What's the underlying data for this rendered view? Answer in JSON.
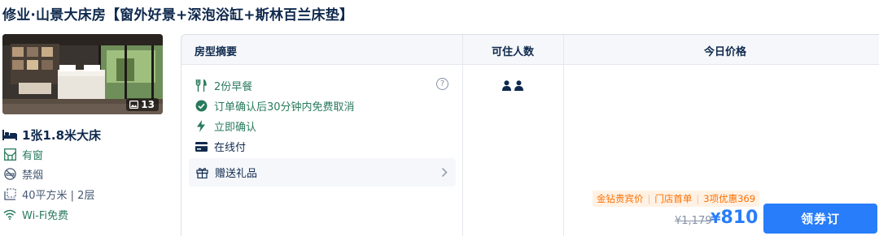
{
  "room": {
    "title": "修业·山景大床房【窗外好景+深泡浴缸+斯林百兰床垫】",
    "photo_count": "13",
    "bed": "1张1.8米大床",
    "window": "有窗",
    "smoking": "禁烟",
    "area_floor": "40平方米 | 2层",
    "wifi": "Wi-Fi免费"
  },
  "table": {
    "headers": {
      "summary": "房型摘要",
      "guests": "可住人数",
      "price": "今日价格"
    }
  },
  "perks": {
    "breakfast": "2份早餐",
    "cancel": "订单确认后30分钟内免费取消",
    "instant": "立即确认",
    "payment": "在线付",
    "gift": "赠送礼品"
  },
  "guests": {
    "count": 2,
    "icon": "person-icon"
  },
  "pricing": {
    "promo_tags": [
      "金钻贵宾价",
      "门店首单",
      "3项优惠369"
    ],
    "original_price": "¥1,179",
    "currency": "¥",
    "price": "810",
    "book_label": "领券订"
  },
  "colors": {
    "accent_blue": "#287dfa",
    "green": "#287a5c",
    "promo_orange": "#ff6f00",
    "text_dark": "#0f294d"
  },
  "icons": {
    "bed": "bed-icon",
    "window": "window-icon",
    "smoking": "no-smoking-icon",
    "area": "area-icon",
    "wifi": "wifi-icon",
    "breakfast": "cutlery-icon",
    "cancel": "check-circle-icon",
    "instant": "lightning-icon",
    "payment": "card-icon",
    "gift": "gift-icon",
    "help": "question-icon",
    "chevron": "chevron-right-icon",
    "photo": "image-icon"
  }
}
